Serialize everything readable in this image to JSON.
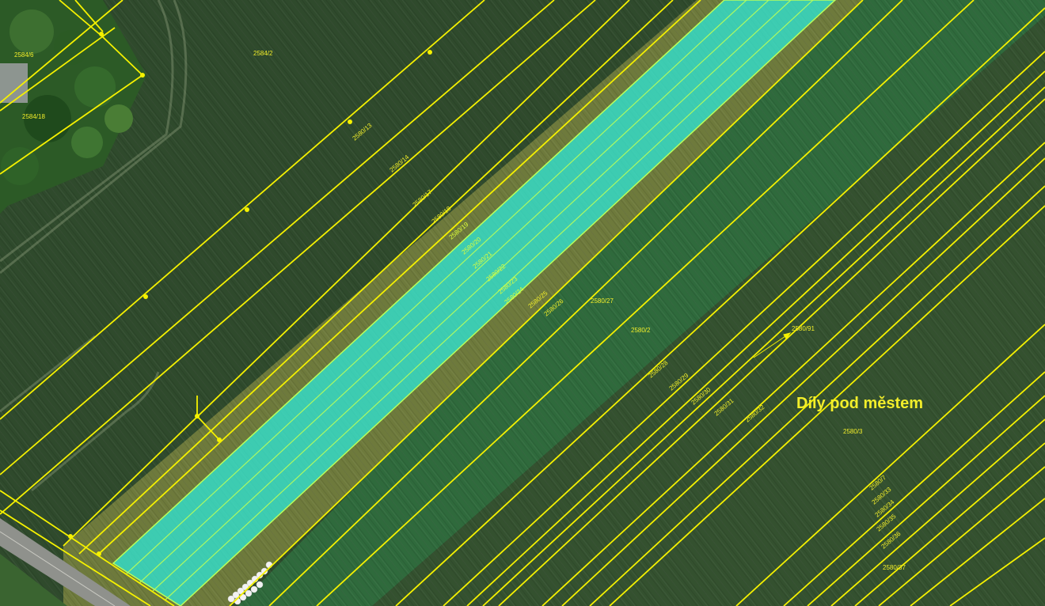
{
  "map": {
    "locality": "Díly pod městem",
    "colors": {
      "parcel_line": "#f2ee00",
      "highlight_fill": "#2ee6d6",
      "highlight_line": "#b8ff5a",
      "field_dark": "#2f4a2c",
      "field_green": "#2f6a3a",
      "field_olive": "#6f7a3a"
    },
    "parcel_labels": [
      "2584/2",
      "2584/6",
      "2584/18",
      "2580/13",
      "2580/14",
      "2580/17",
      "2580/18",
      "2580/19",
      "2580/20",
      "2580/21",
      "2580/22",
      "2580/23",
      "2580/24",
      "2580/25",
      "2580/26",
      "2580/27",
      "2580/2",
      "2580/91",
      "2580/28",
      "2580/29",
      "2580/30",
      "2580/31",
      "2580/32",
      "2580/3",
      "2580/7",
      "2580/33",
      "2580/34",
      "2580/35",
      "2580/36",
      "2580/37"
    ],
    "highlighted_parcels": [
      "2580/19",
      "2580/20",
      "2580/21",
      "2580/22",
      "2580/23",
      "2580/24"
    ]
  }
}
